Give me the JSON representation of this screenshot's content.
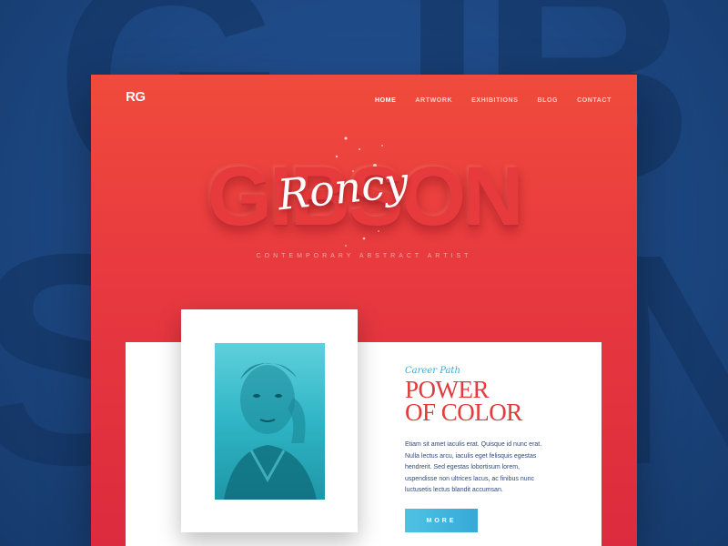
{
  "background": {
    "letters": [
      "G",
      "IB",
      "S",
      "N"
    ]
  },
  "header": {
    "logo": "RG",
    "nav": [
      "HOME",
      "ARTWORK",
      "EXHIBITIONS",
      "BLOG",
      "CONTACT"
    ]
  },
  "hero": {
    "title": "GIBSON",
    "signature": "Roncy",
    "subtitle": "CONTEMPORARY ABSTRACT ARTIST"
  },
  "content": {
    "eyebrow": "Career Path",
    "headline_line1": "POWER",
    "headline_line2": "OF COLOR",
    "body_lines": [
      "Etiam sit amet iaculis erat. Quisque id nunc erat.",
      "Nulla lectus arcu, iaculis eget felisquis egestas",
      "hendrerit. Sed egestas lobortisum lorem,",
      "uspendisse non ultrices lacus, ac finibus nunc",
      "luctusetis lectus blandit accumsan."
    ],
    "button_label": "MORE"
  },
  "colors": {
    "card_red": "#e83a3f",
    "accent_blue": "#39a9d6",
    "background_blue": "#1d4a86",
    "headline_red": "#e23b3b"
  }
}
